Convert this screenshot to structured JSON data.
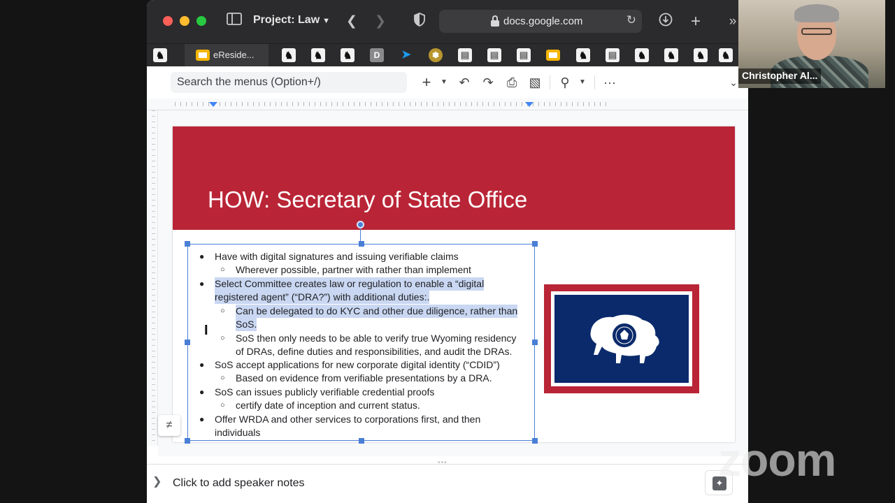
{
  "browser": {
    "project_label": "Project: Law",
    "url": "docs.google.com",
    "active_bookmark_label": "eReside..."
  },
  "docs_toolbar": {
    "menu_search_placeholder": "Search the menus (Option+/)"
  },
  "slide": {
    "title": "HOW: Secretary of State Office",
    "lines": [
      {
        "level": 1,
        "text": "Have with digital signatures and issuing verifiable claims"
      },
      {
        "level": 2,
        "text": "Wherever possible, partner with rather than implement"
      },
      {
        "level": 1,
        "text": "Select Committee creates law or regulation to enable a “digital"
      },
      {
        "level": 0,
        "text": "registered agent” (“DRA?”) with additional duties:."
      },
      {
        "level": 2,
        "text": "Can be delegated to do KYC and other due diligence, rather than"
      },
      {
        "level": 0,
        "text": "SoS."
      },
      {
        "level": 2,
        "text": "SoS then only needs to be able to verify true Wyoming residency"
      },
      {
        "level": 0,
        "text": "of DRAs, define duties and responsibilities, and audit the DRAs."
      },
      {
        "level": 1,
        "text": "SoS accept applications for new corporate digital identity (“CDID”)"
      },
      {
        "level": 2,
        "text": "Based on evidence from verifiable presentations by a DRA."
      },
      {
        "level": 1,
        "text": "SoS can issues publicly verifiable credential proofs"
      },
      {
        "level": 2,
        "text": "certify date of inception and current status."
      },
      {
        "level": 1,
        "text": "Offer WRDA and other services  to corporations first, and then"
      },
      {
        "level": 0,
        "text": "individuals"
      }
    ],
    "flag_colors": {
      "border": "#b92536",
      "field": "#0b2a6b",
      "inner": "#ffffff"
    }
  },
  "speaker_notes": {
    "placeholder": "Click to add speaker notes"
  },
  "webcam": {
    "participant_name": "Christopher Al..."
  },
  "zoom_watermark": "zoom",
  "colors": {
    "slide_header": "#b92536",
    "selection": "#4a7fd6",
    "text_highlight": "#c9d7f2"
  }
}
